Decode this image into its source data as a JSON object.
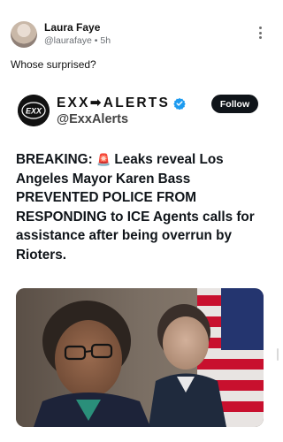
{
  "post": {
    "author_name": "Laura Faye",
    "author_meta": "@laurafaye • 5h",
    "text": "Whose surprised?",
    "menu_icon": "more-vertical-icon"
  },
  "embed": {
    "account_name": "EXX➡ALERTS",
    "handle": "@ExxAlerts",
    "follow_label": "Follow",
    "verified_icon": "verified-badge-icon",
    "avatar_logo_text": "EXX",
    "headline_prefix": "BREAKING:",
    "siren_icon": "🚨",
    "headline_body": "Leaks reveal Los Angeles Mayor Karen Bass PREVENTED POLICE FROM RESPONDING to ICE Agents calls for assistance after being overrun by Rioters."
  },
  "colors": {
    "follow_bg": "#0f1419",
    "verified": "#1d9bf0",
    "flag_red": "#c8102e",
    "flag_blue": "#24356f"
  }
}
